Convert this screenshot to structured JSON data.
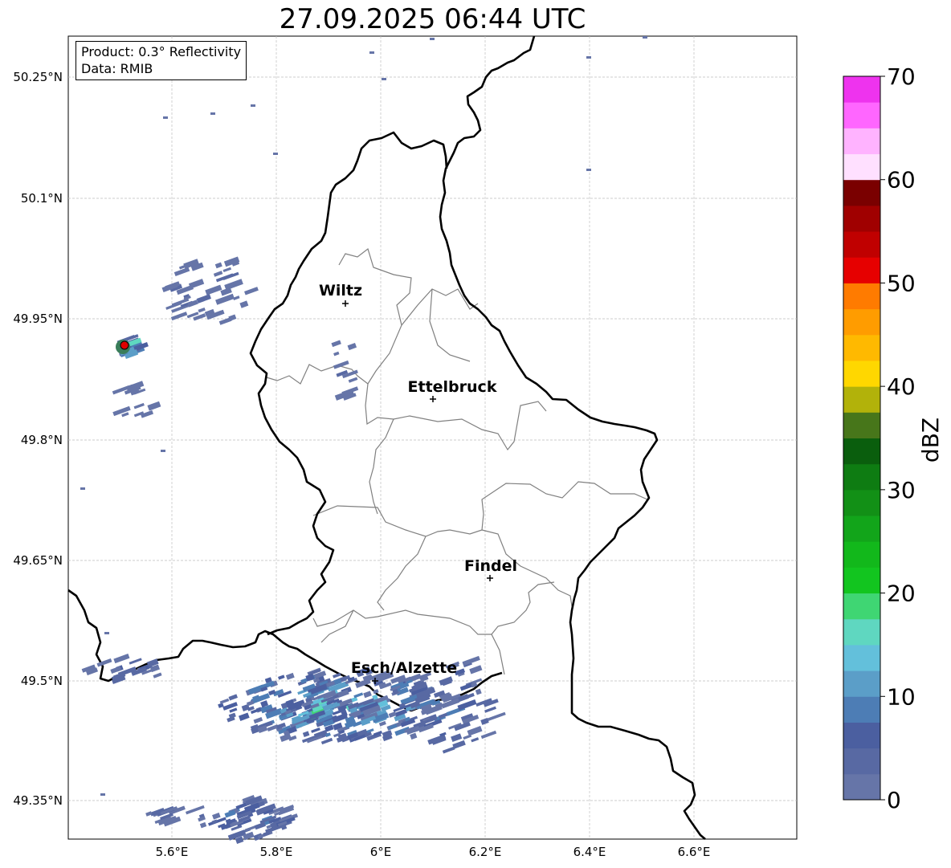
{
  "title": "27.09.2025 06:44 UTC",
  "info": {
    "product": "Product: 0.3° Reflectivity",
    "data": "Data: RMIB"
  },
  "axes": {
    "lon_ticks": [
      "5.6°E",
      "5.8°E",
      "6°E",
      "6.2°E",
      "6.4°E",
      "6.6°E"
    ],
    "lat_ticks": [
      "50.25°N",
      "50.1°N",
      "49.95°N",
      "49.8°N",
      "49.65°N",
      "49.5°N",
      "49.35°N"
    ]
  },
  "cities": [
    {
      "name": "Wiltz"
    },
    {
      "name": "Ettelbruck"
    },
    {
      "name": "Findel"
    },
    {
      "name": "Esch/Alzette"
    }
  ],
  "colorbar": {
    "label": "dBZ",
    "ticks": [
      "0",
      "10",
      "20",
      "30",
      "40",
      "50",
      "60",
      "70"
    ],
    "colors": [
      "#6675a8",
      "#5869a3",
      "#4b5fa0",
      "#4d7db5",
      "#5b9ec8",
      "#63c0db",
      "#5fd7c0",
      "#3fd673",
      "#12c51f",
      "#12b81b",
      "#12a51a",
      "#129016",
      "#0e7c12",
      "#0a5e0d",
      "#47761a",
      "#b2b20a",
      "#ffd700",
      "#ffb900",
      "#ff9c00",
      "#ff7b00",
      "#e60000",
      "#c00000",
      "#a00000",
      "#7a0000",
      "#ffe0ff",
      "#ffb3ff",
      "#ff66ff",
      "#ee33ee"
    ]
  },
  "colors": {
    "border": "#000000",
    "cantons": "#808080",
    "grid": "#bfbfbf",
    "radar_marker": "#e00000"
  }
}
